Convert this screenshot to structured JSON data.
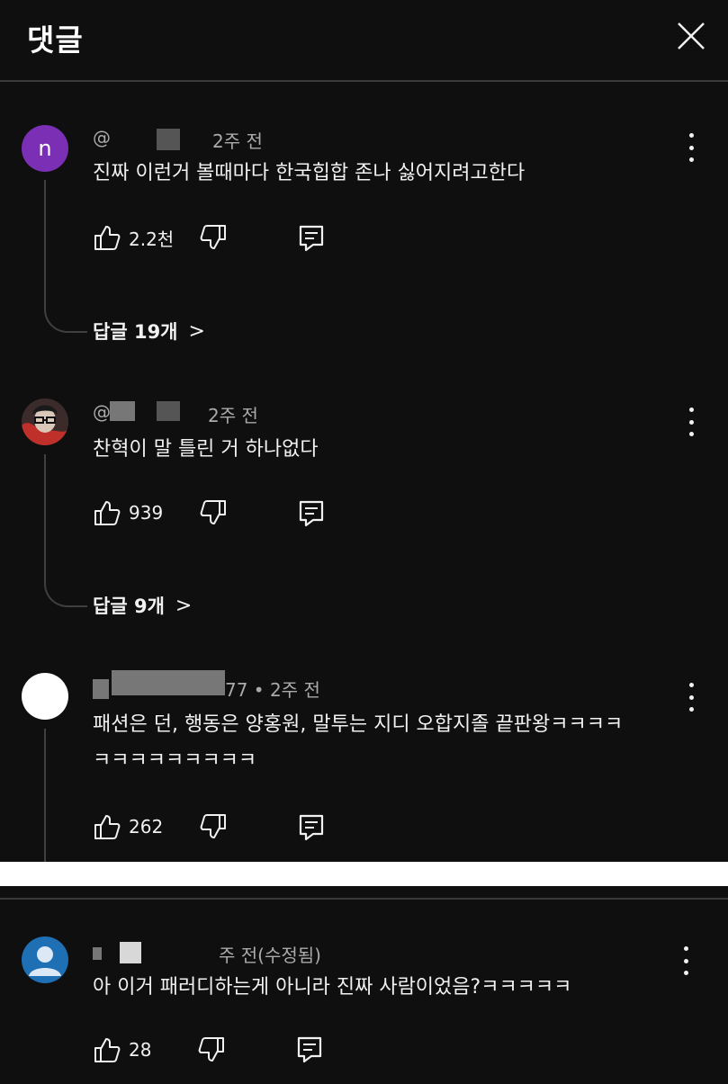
{
  "header": {
    "title": "댓글"
  },
  "comments": [
    {
      "avatar_letter": "n",
      "handle": "@",
      "time": "2주 전",
      "text_lines": [
        "진짜 이런거 볼때마다 한국힙합 존나 싫어지려고한다"
      ],
      "likes": "2.2천",
      "replies_label": "답글 19개",
      "avatar_color": "#7b2fb5"
    },
    {
      "handle": "@​",
      "time": "2주 전",
      "text_lines": [
        "찬혁이 말 틀린 거 하나없다"
      ],
      "likes": "939",
      "replies_label": "답글 9개"
    },
    {
      "handle_suffix": "77 • 2주 전",
      "text_lines": [
        "패션은 던, 행동은 양홍원, 말투는 지디 오합지졸 끝판왕ㅋㅋㅋㅋ",
        "ㅋㅋㅋㅋㅋㅋㅋㅋㅋ"
      ],
      "likes": "262"
    },
    {
      "time": "주 전(수정됨)",
      "text_lines": [
        "아 이거 패러디하는게 아니라 진짜 사람이었음?ㅋㅋㅋㅋㅋ"
      ],
      "likes": "28",
      "avatar_color": "#1f6fb5"
    }
  ],
  "icons": {
    "close": "close-icon",
    "like": "thumbs-up-icon",
    "dislike": "thumbs-down-icon",
    "reply": "reply-icon",
    "more": "more-vertical-icon",
    "chevron": "chevron-right-icon"
  },
  "colors": {
    "background": "#0f0f0f",
    "text": "#f1f1f1",
    "meta": "#aaaaaa",
    "thread": "#3f3f3f"
  }
}
